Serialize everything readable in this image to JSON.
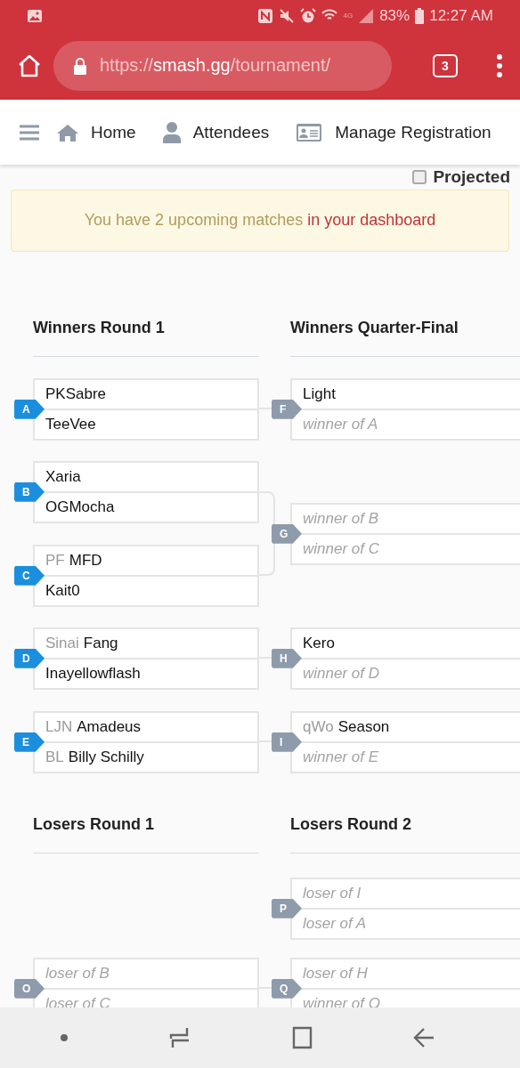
{
  "status_bar": {
    "network": "4G",
    "battery": "83%",
    "time": "12:27 AM"
  },
  "browser": {
    "url_scheme": "https://",
    "url_host": "smash.gg",
    "url_path": "/tournament/",
    "tab_count": "3"
  },
  "nav": {
    "items": [
      {
        "label": "Home"
      },
      {
        "label": "Attendees"
      },
      {
        "label": "Manage Registration"
      }
    ]
  },
  "projected": {
    "label": "Projected",
    "checked": false
  },
  "alert": {
    "text": "You have 2 upcoming matches ",
    "link": "in your dashboard"
  },
  "sections": [
    {
      "rounds": [
        {
          "title": "Winners Round 1",
          "matches": [
            {
              "id": "A",
              "color": "#1b8fdd",
              "entrants": [
                {
                  "kind": "player",
                  "name": "PKSabre"
                },
                {
                  "kind": "player",
                  "name": "TeeVee"
                }
              ]
            },
            {
              "id": "B",
              "color": "#1b8fdd",
              "entrants": [
                {
                  "kind": "player",
                  "name": "Xaria"
                },
                {
                  "kind": "player",
                  "name": "OGMocha"
                }
              ]
            },
            {
              "id": "C",
              "color": "#1b8fdd",
              "entrants": [
                {
                  "kind": "player",
                  "prefix": "PF",
                  "name": "MFD"
                },
                {
                  "kind": "player",
                  "name": "Kait0"
                }
              ]
            },
            {
              "id": "D",
              "color": "#1b8fdd",
              "entrants": [
                {
                  "kind": "player",
                  "prefix": "Sinai",
                  "name": "Fang"
                },
                {
                  "kind": "player",
                  "name": "Inayellowflash"
                }
              ]
            },
            {
              "id": "E",
              "color": "#1b8fdd",
              "entrants": [
                {
                  "kind": "player",
                  "prefix": "LJN",
                  "name": "Amadeus"
                },
                {
                  "kind": "player",
                  "prefix": "BL",
                  "name": "Billy Schilly"
                }
              ]
            }
          ]
        },
        {
          "title": "Winners Quarter-Final",
          "matches": [
            {
              "id": "F",
              "color": "#8e9bab",
              "entrants": [
                {
                  "kind": "player",
                  "name": "Light"
                },
                {
                  "kind": "pending",
                  "text": "winner of A"
                }
              ]
            },
            {
              "id": "G",
              "color": "#8e9bab",
              "entrants": [
                {
                  "kind": "pending",
                  "text": "winner of B"
                },
                {
                  "kind": "pending",
                  "text": "winner of C"
                }
              ]
            },
            {
              "id": "H",
              "color": "#8e9bab",
              "entrants": [
                {
                  "kind": "player",
                  "name": "Kero"
                },
                {
                  "kind": "pending",
                  "text": "winner of D"
                }
              ]
            },
            {
              "id": "I",
              "color": "#8e9bab",
              "entrants": [
                {
                  "kind": "player",
                  "prefix": "qWo",
                  "name": "Season"
                },
                {
                  "kind": "pending",
                  "text": "winner of E"
                }
              ]
            }
          ]
        }
      ]
    },
    {
      "rounds": [
        {
          "title": "Losers Round 1",
          "matches": [
            {
              "id": "O",
              "color": "#8e9bab",
              "entrants": [
                {
                  "kind": "pending",
                  "text": "loser of B"
                },
                {
                  "kind": "pending",
                  "text": "loser of C"
                }
              ]
            }
          ]
        },
        {
          "title": "Losers Round 2",
          "matches": [
            {
              "id": "P",
              "color": "#8e9bab",
              "entrants": [
                {
                  "kind": "pending",
                  "text": "loser of I"
                },
                {
                  "kind": "pending",
                  "text": "loser of A"
                }
              ]
            },
            {
              "id": "Q",
              "color": "#8e9bab",
              "entrants": [
                {
                  "kind": "pending",
                  "text": "loser of H"
                },
                {
                  "kind": "pending",
                  "text": "winner of O"
                }
              ]
            }
          ]
        }
      ]
    }
  ]
}
